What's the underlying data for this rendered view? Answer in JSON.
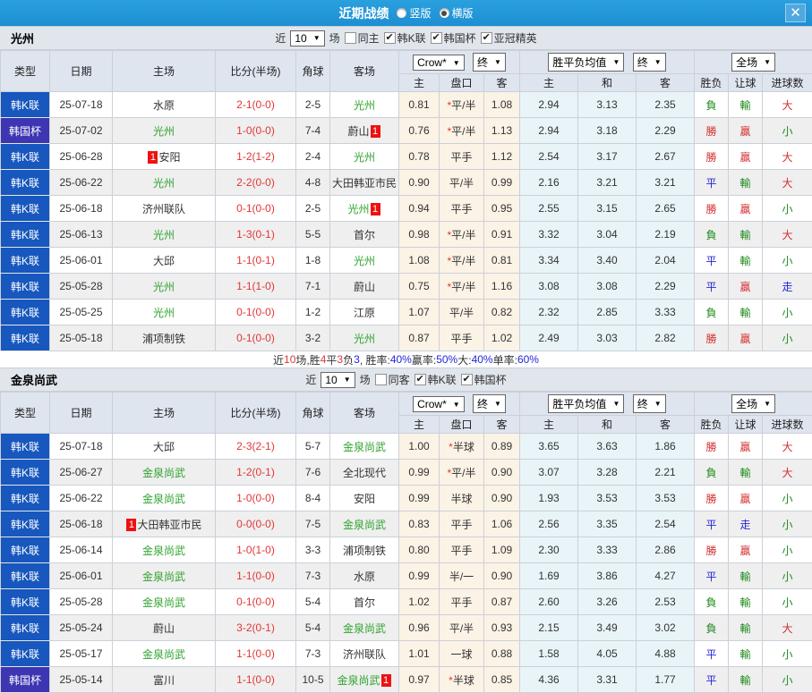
{
  "titlebar": {
    "title": "近期战绩",
    "vertical_label": "竖版",
    "horizontal_label": "横版",
    "close_label": "✕"
  },
  "labels": {
    "near": "近",
    "games_suffix": "场"
  },
  "columns": {
    "type": "类型",
    "date": "日期",
    "home": "主场",
    "score": "比分(半场)",
    "corners": "角球",
    "away": "客场",
    "asian_home": "主",
    "asian_handicap": "盘口",
    "asian_away": "客",
    "euro_home": "主",
    "euro_draw": "和",
    "euro_away": "客",
    "result": "胜负",
    "handicap_result": "让球",
    "goals": "进球数"
  },
  "dropdowns": {
    "odds_source": "Crow*",
    "final": "终",
    "euro_avg": "胜平负均值",
    "scope": "全场"
  },
  "colors": {
    "accent_blue": "#1D8FD2",
    "league_blue": "#1757BE",
    "cup_purple": "#3D35B2",
    "focus_green": "#2FA32F",
    "loss_green": "#1F8A1F",
    "win_red": "#D43030",
    "draw_blue": "#2525D8",
    "asian_bg": "#FBF3E6",
    "euro_bg": "#E9F4F8"
  },
  "sections": [
    {
      "team": "光州",
      "filter": {
        "games": "10",
        "same_label": "同主",
        "same_checked": false,
        "leagues": [
          {
            "label": "韩K联",
            "checked": true
          },
          {
            "label": "韩国杯",
            "checked": true
          },
          {
            "label": "亚冠精英",
            "checked": true
          }
        ]
      },
      "rows": [
        {
          "type": "韩K联",
          "date": "25-07-18",
          "home": {
            "name": "水原"
          },
          "score": "2-1",
          "half": "(0-0)",
          "corners": "2-5",
          "away": {
            "name": "光州",
            "focus": true
          },
          "star": true,
          "asian": [
            "0.81",
            "平/半",
            "1.08"
          ],
          "euro": [
            "2.94",
            "3.13",
            "2.35"
          ],
          "result": "負",
          "handicap_result": "輸",
          "goals": "大"
        },
        {
          "type": "韩国杯",
          "date": "25-07-02",
          "home": {
            "name": "光州",
            "focus": true
          },
          "score": "1-0",
          "half": "(0-0)",
          "corners": "7-4",
          "away": {
            "name": "蔚山",
            "badge": "after",
            "badge_label": "1"
          },
          "star": true,
          "asian": [
            "0.76",
            "平/半",
            "1.13"
          ],
          "euro": [
            "2.94",
            "3.18",
            "2.29"
          ],
          "result": "勝",
          "handicap_result": "贏",
          "goals": "小"
        },
        {
          "type": "韩K联",
          "date": "25-06-28",
          "home": {
            "name": "安阳",
            "badge": "before",
            "badge_label": "1"
          },
          "score": "1-2",
          "half": "(1-2)",
          "corners": "2-4",
          "away": {
            "name": "光州",
            "focus": true
          },
          "star": false,
          "asian": [
            "0.78",
            "平手",
            "1.12"
          ],
          "euro": [
            "2.54",
            "3.17",
            "2.67"
          ],
          "result": "勝",
          "handicap_result": "贏",
          "goals": "大"
        },
        {
          "type": "韩K联",
          "date": "25-06-22",
          "home": {
            "name": "光州",
            "focus": true
          },
          "score": "2-2",
          "half": "(0-0)",
          "corners": "4-8",
          "away": {
            "name": "大田韩亚市民"
          },
          "star": false,
          "asian": [
            "0.90",
            "平/半",
            "0.99"
          ],
          "euro": [
            "2.16",
            "3.21",
            "3.21"
          ],
          "result": "平",
          "handicap_result": "輸",
          "goals": "大"
        },
        {
          "type": "韩K联",
          "date": "25-06-18",
          "home": {
            "name": "济州联队"
          },
          "score": "0-1",
          "half": "(0-0)",
          "corners": "2-5",
          "away": {
            "name": "光州",
            "focus": true,
            "badge": "after",
            "badge_label": "1"
          },
          "star": false,
          "asian": [
            "0.94",
            "平手",
            "0.95"
          ],
          "euro": [
            "2.55",
            "3.15",
            "2.65"
          ],
          "result": "勝",
          "handicap_result": "贏",
          "goals": "小"
        },
        {
          "type": "韩K联",
          "date": "25-06-13",
          "home": {
            "name": "光州",
            "focus": true
          },
          "score": "1-3",
          "half": "(0-1)",
          "corners": "5-5",
          "away": {
            "name": "首尔"
          },
          "star": true,
          "asian": [
            "0.98",
            "平/半",
            "0.91"
          ],
          "euro": [
            "3.32",
            "3.04",
            "2.19"
          ],
          "result": "負",
          "handicap_result": "輸",
          "goals": "大"
        },
        {
          "type": "韩K联",
          "date": "25-06-01",
          "home": {
            "name": "大邱"
          },
          "score": "1-1",
          "half": "(0-1)",
          "corners": "1-8",
          "away": {
            "name": "光州",
            "focus": true
          },
          "star": true,
          "asian": [
            "1.08",
            "平/半",
            "0.81"
          ],
          "euro": [
            "3.34",
            "3.40",
            "2.04"
          ],
          "result": "平",
          "handicap_result": "輸",
          "goals": "小"
        },
        {
          "type": "韩K联",
          "date": "25-05-28",
          "home": {
            "name": "光州",
            "focus": true
          },
          "score": "1-1",
          "half": "(1-0)",
          "corners": "7-1",
          "away": {
            "name": "蔚山"
          },
          "star": true,
          "asian": [
            "0.75",
            "平/半",
            "1.16"
          ],
          "euro": [
            "3.08",
            "3.08",
            "2.29"
          ],
          "result": "平",
          "handicap_result": "贏",
          "goals": "走"
        },
        {
          "type": "韩K联",
          "date": "25-05-25",
          "home": {
            "name": "光州",
            "focus": true
          },
          "score": "0-1",
          "half": "(0-0)",
          "corners": "1-2",
          "away": {
            "name": "江原"
          },
          "star": false,
          "asian": [
            "1.07",
            "平/半",
            "0.82"
          ],
          "euro": [
            "2.32",
            "2.85",
            "3.33"
          ],
          "result": "負",
          "handicap_result": "輸",
          "goals": "小"
        },
        {
          "type": "韩K联",
          "date": "25-05-18",
          "home": {
            "name": "浦项制铁"
          },
          "score": "0-1",
          "half": "(0-0)",
          "corners": "3-2",
          "away": {
            "name": "光州",
            "focus": true
          },
          "star": false,
          "asian": [
            "0.87",
            "平手",
            "1.02"
          ],
          "euro": [
            "2.49",
            "3.03",
            "2.82"
          ],
          "result": "勝",
          "handicap_result": "贏",
          "goals": "小"
        }
      ],
      "summary": [
        {
          "t": "近",
          "c": "k"
        },
        {
          "t": "10",
          "c": "r"
        },
        {
          "t": "场,胜",
          "c": "k"
        },
        {
          "t": "4",
          "c": "r"
        },
        {
          "t": "平",
          "c": "k"
        },
        {
          "t": "3",
          "c": "r"
        },
        {
          "t": "负",
          "c": "k"
        },
        {
          "t": "3",
          "c": "b"
        },
        {
          "t": ", 胜率:",
          "c": "k"
        },
        {
          "t": "40%",
          "c": "b"
        },
        {
          "t": " 赢率:",
          "c": "k"
        },
        {
          "t": "50%",
          "c": "b"
        },
        {
          "t": " 大:",
          "c": "k"
        },
        {
          "t": "40%",
          "c": "b"
        },
        {
          "t": " 单率:",
          "c": "k"
        },
        {
          "t": "60%",
          "c": "b"
        }
      ]
    },
    {
      "team": "金泉尚武",
      "filter": {
        "games": "10",
        "same_label": "同客",
        "same_checked": false,
        "leagues": [
          {
            "label": "韩K联",
            "checked": true
          },
          {
            "label": "韩国杯",
            "checked": true
          }
        ]
      },
      "rows": [
        {
          "type": "韩K联",
          "date": "25-07-18",
          "home": {
            "name": "大邱"
          },
          "score": "2-3",
          "half": "(2-1)",
          "corners": "5-7",
          "away": {
            "name": "金泉尚武",
            "focus": true
          },
          "star": true,
          "asian": [
            "1.00",
            "半球",
            "0.89"
          ],
          "euro": [
            "3.65",
            "3.63",
            "1.86"
          ],
          "result": "勝",
          "handicap_result": "贏",
          "goals": "大"
        },
        {
          "type": "韩K联",
          "date": "25-06-27",
          "home": {
            "name": "金泉尚武",
            "focus": true
          },
          "score": "1-2",
          "half": "(0-1)",
          "corners": "7-6",
          "away": {
            "name": "全北现代"
          },
          "star": true,
          "asian": [
            "0.99",
            "平/半",
            "0.90"
          ],
          "euro": [
            "3.07",
            "3.28",
            "2.21"
          ],
          "result": "負",
          "handicap_result": "輸",
          "goals": "大"
        },
        {
          "type": "韩K联",
          "date": "25-06-22",
          "home": {
            "name": "金泉尚武",
            "focus": true
          },
          "score": "1-0",
          "half": "(0-0)",
          "corners": "8-4",
          "away": {
            "name": "安阳"
          },
          "star": false,
          "asian": [
            "0.99",
            "半球",
            "0.90"
          ],
          "euro": [
            "1.93",
            "3.53",
            "3.53"
          ],
          "result": "勝",
          "handicap_result": "贏",
          "goals": "小"
        },
        {
          "type": "韩K联",
          "date": "25-06-18",
          "home": {
            "name": "大田韩亚市民",
            "badge": "before",
            "badge_label": "1"
          },
          "score": "0-0",
          "half": "(0-0)",
          "corners": "7-5",
          "away": {
            "name": "金泉尚武",
            "focus": true
          },
          "star": false,
          "asian": [
            "0.83",
            "平手",
            "1.06"
          ],
          "euro": [
            "2.56",
            "3.35",
            "2.54"
          ],
          "result": "平",
          "handicap_result": "走",
          "goals": "小"
        },
        {
          "type": "韩K联",
          "date": "25-06-14",
          "home": {
            "name": "金泉尚武",
            "focus": true
          },
          "score": "1-0",
          "half": "(1-0)",
          "corners": "3-3",
          "away": {
            "name": "浦项制铁"
          },
          "star": false,
          "asian": [
            "0.80",
            "平手",
            "1.09"
          ],
          "euro": [
            "2.30",
            "3.33",
            "2.86"
          ],
          "result": "勝",
          "handicap_result": "贏",
          "goals": "小"
        },
        {
          "type": "韩K联",
          "date": "25-06-01",
          "home": {
            "name": "金泉尚武",
            "focus": true
          },
          "score": "1-1",
          "half": "(0-0)",
          "corners": "7-3",
          "away": {
            "name": "水原"
          },
          "star": false,
          "asian": [
            "0.99",
            "半/一",
            "0.90"
          ],
          "euro": [
            "1.69",
            "3.86",
            "4.27"
          ],
          "result": "平",
          "handicap_result": "輸",
          "goals": "小"
        },
        {
          "type": "韩K联",
          "date": "25-05-28",
          "home": {
            "name": "金泉尚武",
            "focus": true
          },
          "score": "0-1",
          "half": "(0-0)",
          "corners": "5-4",
          "away": {
            "name": "首尔"
          },
          "star": false,
          "asian": [
            "1.02",
            "平手",
            "0.87"
          ],
          "euro": [
            "2.60",
            "3.26",
            "2.53"
          ],
          "result": "負",
          "handicap_result": "輸",
          "goals": "小"
        },
        {
          "type": "韩K联",
          "date": "25-05-24",
          "home": {
            "name": "蔚山"
          },
          "score": "3-2",
          "half": "(0-1)",
          "corners": "5-4",
          "away": {
            "name": "金泉尚武",
            "focus": true
          },
          "star": false,
          "asian": [
            "0.96",
            "平/半",
            "0.93"
          ],
          "euro": [
            "2.15",
            "3.49",
            "3.02"
          ],
          "result": "負",
          "handicap_result": "輸",
          "goals": "大"
        },
        {
          "type": "韩K联",
          "date": "25-05-17",
          "home": {
            "name": "金泉尚武",
            "focus": true
          },
          "score": "1-1",
          "half": "(0-0)",
          "corners": "7-3",
          "away": {
            "name": "济州联队"
          },
          "star": false,
          "asian": [
            "1.01",
            "一球",
            "0.88"
          ],
          "euro": [
            "1.58",
            "4.05",
            "4.88"
          ],
          "result": "平",
          "handicap_result": "輸",
          "goals": "小"
        },
        {
          "type": "韩国杯",
          "date": "25-05-14",
          "home": {
            "name": "富川"
          },
          "score": "1-1",
          "half": "(0-0)",
          "corners": "10-5",
          "away": {
            "name": "金泉尚武",
            "focus": true,
            "badge": "after",
            "badge_label": "1"
          },
          "star": true,
          "asian": [
            "0.97",
            "半球",
            "0.85"
          ],
          "euro": [
            "4.36",
            "3.31",
            "1.77"
          ],
          "result": "平",
          "handicap_result": "輸",
          "goals": "小"
        }
      ],
      "summary": null
    }
  ]
}
